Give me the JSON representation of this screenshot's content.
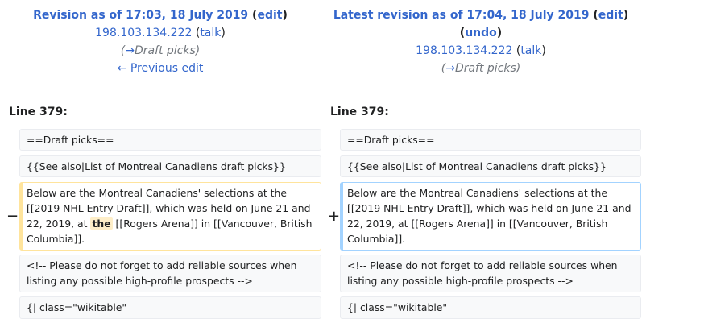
{
  "left_header": {
    "title": "Revision as of 17:03, 18 July 2019",
    "edit_label": "edit",
    "user": "198.103.134.222",
    "talk_label": "talk",
    "summary_arrow": "→",
    "summary": "Draft picks",
    "prev_label": "← Previous edit"
  },
  "right_header": {
    "title": "Latest revision as of 17:04, 18 July 2019",
    "edit_label": "edit",
    "undo_label": "undo",
    "user": "198.103.134.222",
    "talk_label": "talk",
    "summary_arrow": "→",
    "summary": "Draft picks"
  },
  "left_line": "Line 379:",
  "right_line": "Line 379:",
  "markers": {
    "minus": "−",
    "plus": "+"
  },
  "rows": {
    "r1": "==Draft picks==",
    "r2": "{{See also|List of Montreal Canadiens draft picks}}",
    "r3_left_pre": "Below are the Montreal Canadiens' selections at the [[2019 NHL Entry Draft]], which was held on June 21 and 22, 2019, at ",
    "r3_left_hl": "the",
    "r3_left_post": " [[Rogers Arena]] in [[Vancouver, British Columbia]].",
    "r3_right": "Below are the Montreal Canadiens' selections at the [[2019 NHL Entry Draft]], which was held on June 21 and 22, 2019, at [[Rogers Arena]] in [[Vancouver, British Columbia]].",
    "r4": "<!-- Please do not forget to add reliable sources when listing any possible high-profile prospects -->",
    "r5": "{| class=\"wikitable\""
  }
}
